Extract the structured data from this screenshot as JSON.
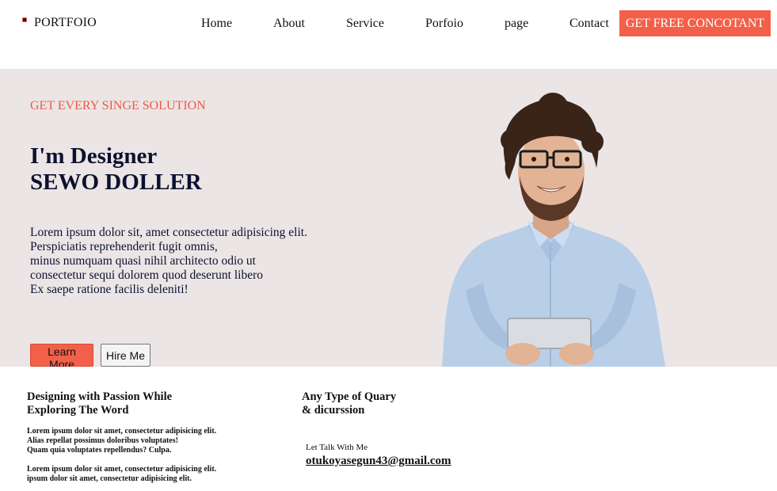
{
  "nav": {
    "logo_text": "PORTFOIO",
    "links": [
      "Home",
      "About",
      "Service",
      "Porfoio",
      "page",
      "Contact"
    ],
    "cta_label": "GET FREE CONCOTANT"
  },
  "hero": {
    "eyebrow": "GET EVERY SINGE SOLUTION",
    "headline_line1": "I'm Designer",
    "headline_line2": "SEWO DOLLER",
    "paragraph_lines": [
      "Lorem ipsum dolor sit, amet consectetur adipisicing elit.",
      "Perspiciatis reprehenderit fugit omnis,",
      "minus numquam quasi nihil architecto odio ut",
      "consectetur sequi dolorem quod deserunt libero",
      "Ex saepe ratione facilis deleniti!"
    ],
    "learn_more_label": "Learn More",
    "hire_me_label": "Hire Me"
  },
  "about": {
    "heading_line1": "Designing with Passion While",
    "heading_line2": "Exploring The Word",
    "para1_lines": [
      "Lorem ipsum dolor sit amet, consectetur adipisicing elit.",
      "Alias repellat possimus doloribus voluptates!",
      "Quam quia voluptates repellendus? Culpa."
    ],
    "para2_lines": [
      "Lorem ipsum dolor sit amet, consectetur adipisicing elit.",
      "ipsum dolor sit amet, consectetur adipisicing elit."
    ]
  },
  "contact": {
    "heading_line1": "Any Type of Quary",
    "heading_line2": "& dicurssion",
    "talk_label": "Let Talk With Me",
    "email": "otukoyasegun43@gmail.com"
  },
  "colors": {
    "accent": "#f3604a",
    "hero_bg": "#ebe5e5",
    "headline": "#0d1130"
  }
}
